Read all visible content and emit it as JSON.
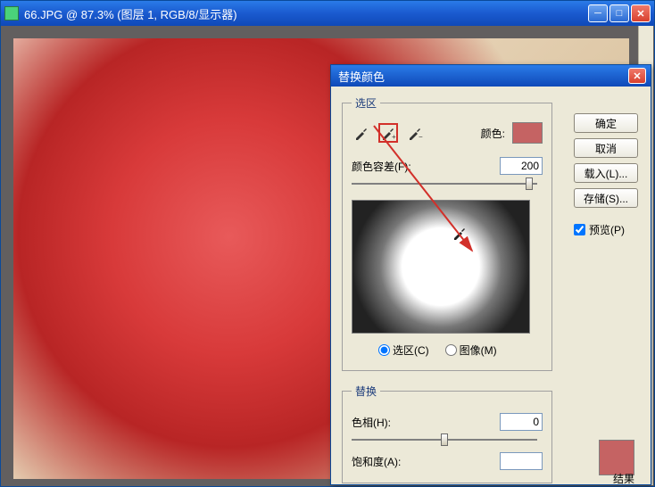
{
  "main_window": {
    "title": "66.JPG @ 87.3% (图层 1, RGB/8/显示器)"
  },
  "dialog": {
    "title": "替换颜色",
    "buttons": {
      "ok": "确定",
      "cancel": "取消",
      "load": "载入(L)...",
      "save": "存储(S)..."
    },
    "preview_checkbox": "预览(P)",
    "selection": {
      "legend": "选区",
      "color_label": "颜色:",
      "swatch_color": "#c56363",
      "fuzziness_label": "颜色容差(F):",
      "fuzziness_value": "200",
      "radio_selection": "选区(C)",
      "radio_image": "图像(M)"
    },
    "replace": {
      "legend": "替换",
      "hue_label": "色相(H):",
      "hue_value": "0",
      "saturation_label": "饱和度(A):",
      "result_label": "结果"
    }
  },
  "icons": {
    "eyedropper": "eyedropper",
    "eyedropper_plus": "eyedropper-plus",
    "eyedropper_minus": "eyedropper-minus"
  }
}
